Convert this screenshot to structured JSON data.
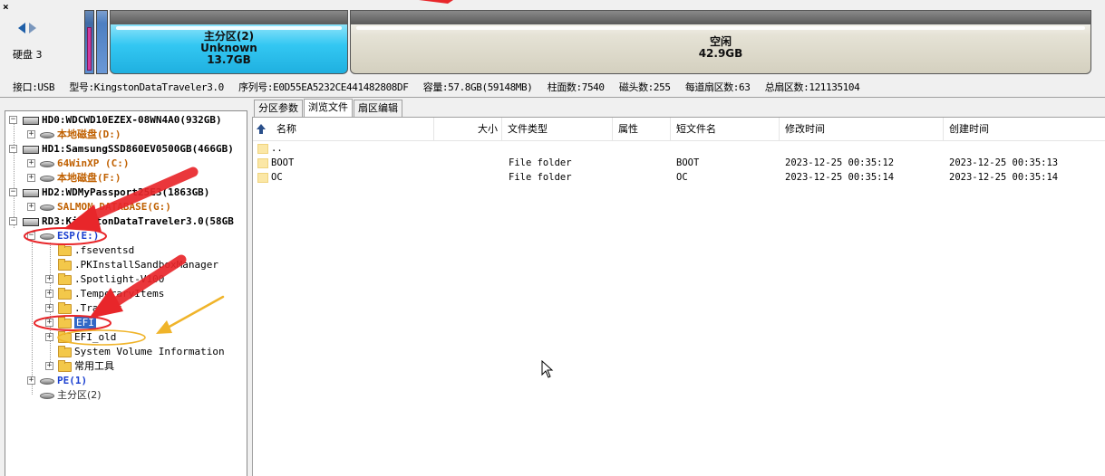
{
  "window": {
    "close_glyph": "×"
  },
  "disk_map": {
    "label": "硬盘 3",
    "partitions": [
      {
        "name": "主分区(2)",
        "fs": "Unknown",
        "size": "13.7GB"
      },
      {
        "name": "空闲",
        "fs": "",
        "size": "42.9GB"
      }
    ]
  },
  "disk_info": {
    "interface": "接口:USB",
    "model": "型号:KingstonDataTraveler3.0",
    "serial": "序列号:E0D55EA5232CE441482808DF",
    "capacity": "容量:57.8GB(59148MB)",
    "cylinders": "柱面数:7540",
    "heads": "磁头数:255",
    "sectors_per_track": "每道扇区数:63",
    "total_sectors": "总扇区数:121135104"
  },
  "tree": {
    "hd0": "HD0:WDCWD10EZEX-08WN4A0(932GB)",
    "hd0_local": "本地磁盘(D:)",
    "hd1": "HD1:SamsungSSD860EV0500GB(466GB)",
    "hd1_winxp": "64WinXP (C:)",
    "hd1_local": "本地磁盘(F:)",
    "hd2": "HD2:WDMyPassport25E3(1863GB)",
    "hd2_salmon": "SALMON DATABASE(G:)",
    "rd3": "RD3:KingstonDataTraveler3.0(58GB",
    "esp": "ESP(E:)",
    "folders": [
      ".fseventsd",
      ".PKInstallSandboxManager",
      ".Spotlight-V100",
      ".TemporaryItems",
      ".Trashes",
      "EFI",
      "EFI_old",
      "System Volume Information",
      "常用工具"
    ],
    "pe": "PE(1)",
    "primary": "主分区(2)"
  },
  "tabs": [
    "分区参数",
    "浏览文件",
    "扇区编辑"
  ],
  "file_columns": [
    "名称",
    "大小",
    "文件类型",
    "属性",
    "短文件名",
    "修改时间",
    "创建时间"
  ],
  "parent_dir": "..",
  "files": [
    {
      "name": "BOOT",
      "size": "",
      "type": "File folder",
      "attr": "",
      "short": "BOOT",
      "modified": "2023-12-25 00:35:12",
      "created": "2023-12-25 00:35:13"
    },
    {
      "name": "OC",
      "size": "",
      "type": "File folder",
      "attr": "",
      "short": "OC",
      "modified": "2023-12-25 00:35:14",
      "created": "2023-12-25 00:35:14"
    }
  ],
  "colors": {
    "selection": "#3168c6",
    "annotation_red": "#e8262a",
    "annotation_yellow": "#f0b42a",
    "partition_cyan": "#33c7f2"
  }
}
